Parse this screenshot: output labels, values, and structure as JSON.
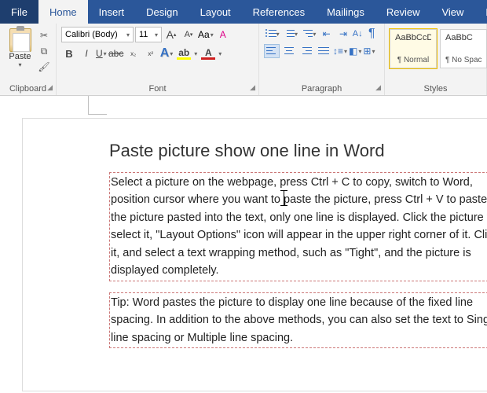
{
  "menu": {
    "file": "File",
    "home": "Home",
    "insert": "Insert",
    "design": "Design",
    "layout": "Layout",
    "references": "References",
    "mailings": "Mailings",
    "review": "Review",
    "view": "View",
    "help": "Help",
    "active": "Home"
  },
  "clipboard": {
    "paste": "Paste",
    "group_label": "Clipboard"
  },
  "font": {
    "family": "Calibri (Body)",
    "size": "11",
    "bold": "B",
    "italic": "I",
    "underline": "U",
    "strike": "abc",
    "sub": "x",
    "sup": "x",
    "bigA": "A",
    "smallA": "A",
    "caseAa": "Aa",
    "group_label": "Font"
  },
  "paragraph": {
    "group_label": "Paragraph"
  },
  "styles": {
    "group_label": "Styles",
    "items": [
      {
        "preview": "AaBbCcDc",
        "name": "¶ Normal"
      },
      {
        "preview": "AaBbC",
        "name": "¶ No Spacing"
      }
    ]
  },
  "document": {
    "title": "Paste picture show one line in Word",
    "p1": "Select a picture on the webpage, press Ctrl + C to copy, switch to Word, position cursor where you want to paste the picture, press Ctrl + V to paste, the picture pasted into the text, only one line is displayed. Click the picture to select it, \"Layout Options\" icon will appear in the upper right corner of it. Click it, and select a text wrapping method, such as \"Tight\", and the picture is displayed completely.",
    "p2": "Tip: Word pastes the picture to display one line because of the fixed line spacing. In addition to the above methods, you can also set the text to Single line spacing or Multiple line spacing."
  }
}
